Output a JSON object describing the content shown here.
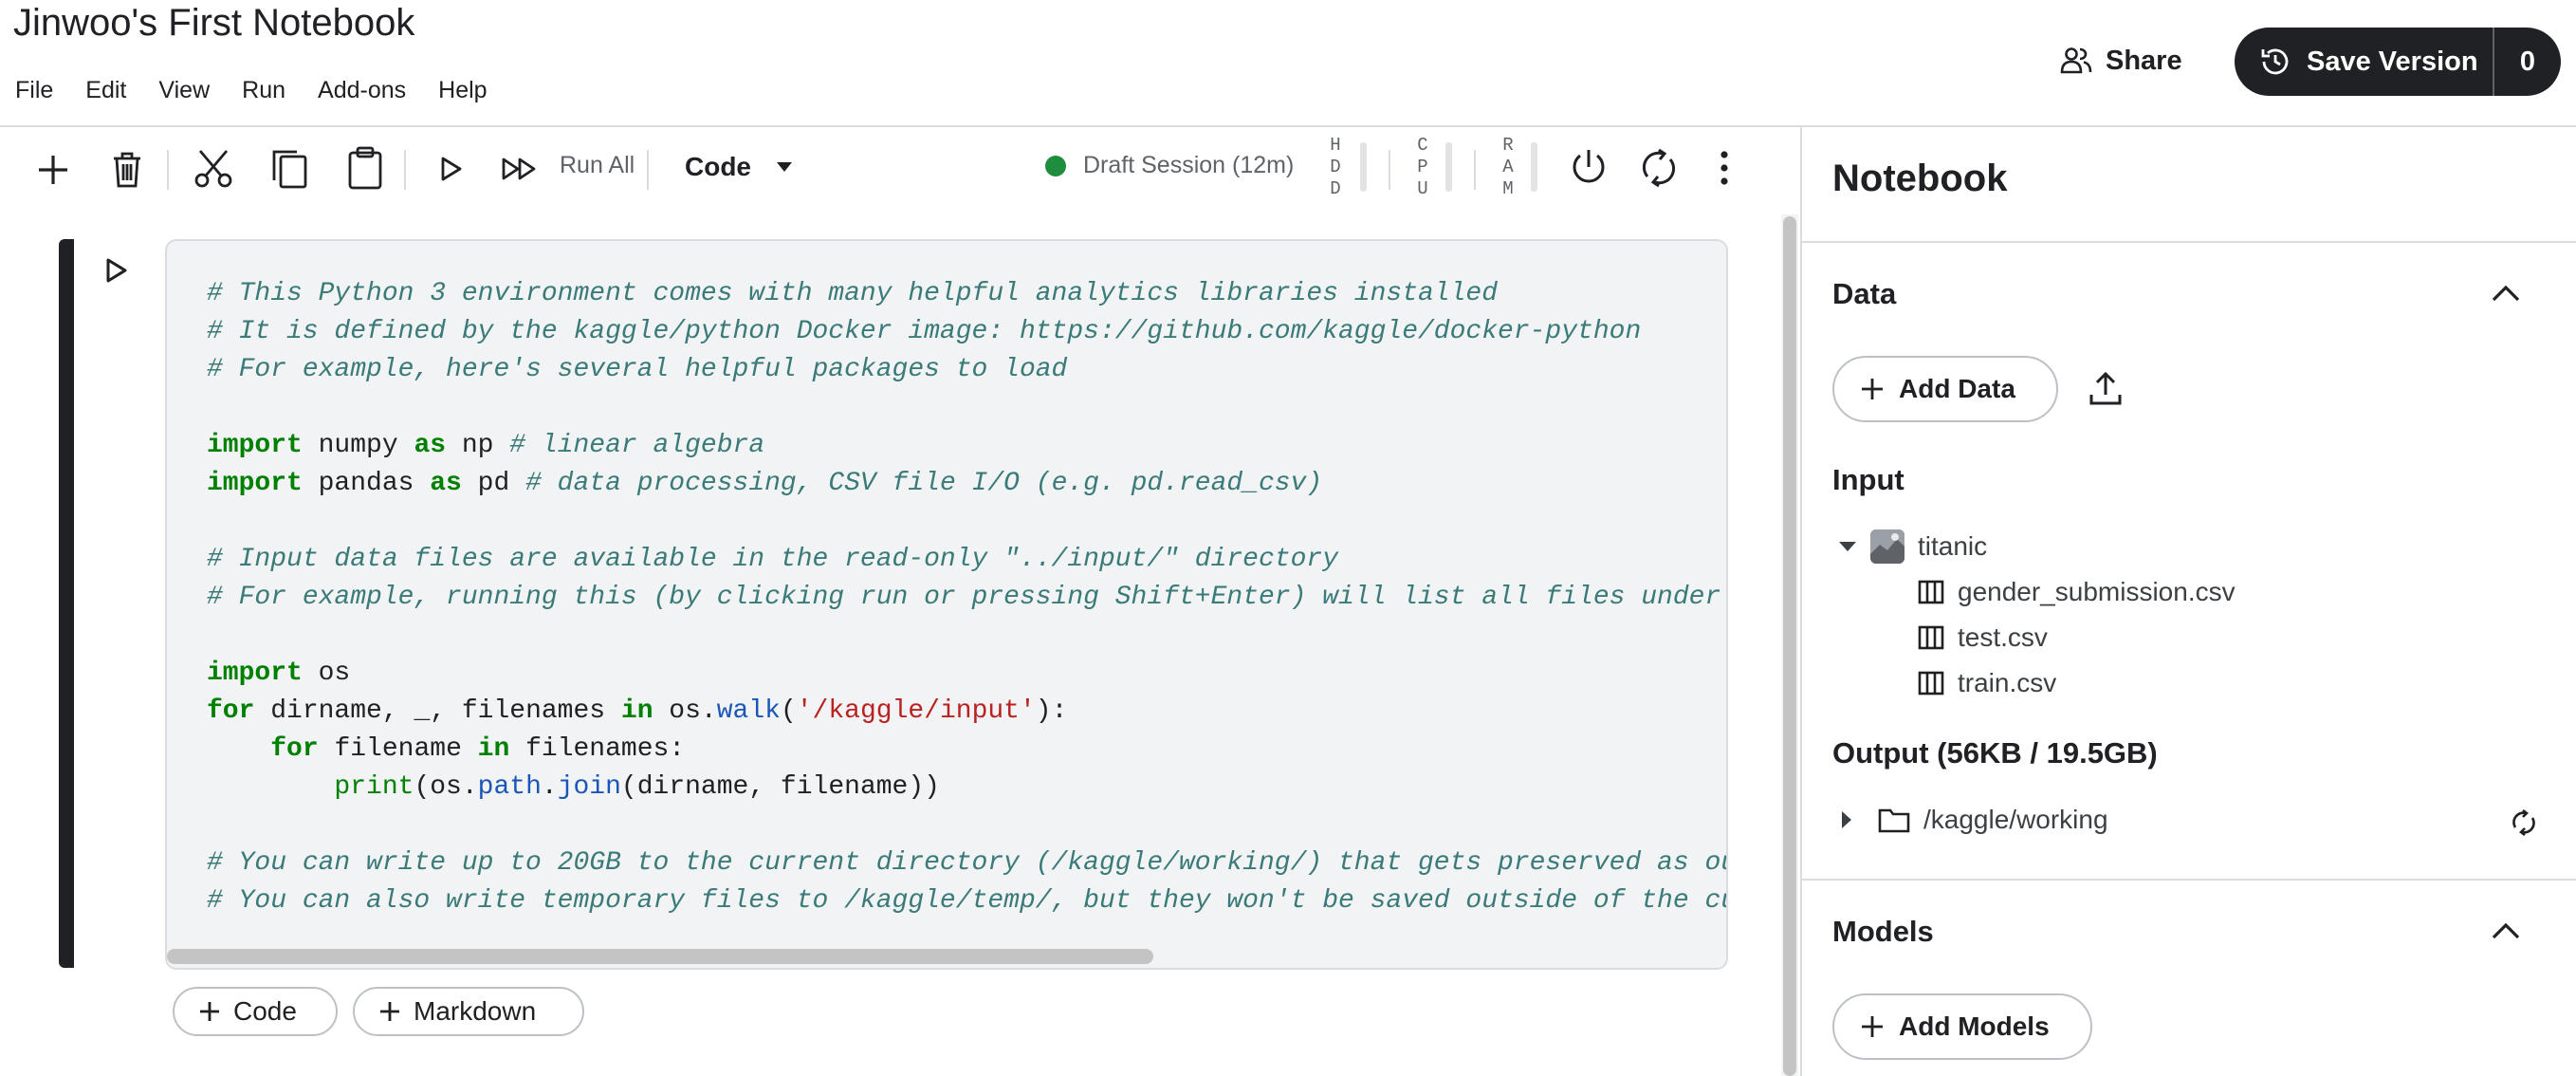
{
  "header": {
    "notebook_title": "Jinwoo's First Notebook",
    "menu": [
      "File",
      "Edit",
      "View",
      "Run",
      "Add-ons",
      "Help"
    ],
    "share_label": "Share",
    "save_version_label": "Save Version",
    "save_version_count": "0"
  },
  "toolbar": {
    "run_all_label": "Run All",
    "cell_type": "Code",
    "session_label": "Draft Session (12m)",
    "session_status_color": "#1e8e3e",
    "resources": [
      {
        "label": [
          "H",
          "D",
          "D"
        ]
      },
      {
        "label": [
          "C",
          "P",
          "U"
        ]
      },
      {
        "label": [
          "R",
          "A",
          "M"
        ]
      }
    ]
  },
  "cell": {
    "lines": [
      [
        {
          "t": "cm",
          "v": "# This Python 3 environment comes with many helpful analytics libraries installed"
        }
      ],
      [
        {
          "t": "cm",
          "v": "# It is defined by the kaggle/python Docker image: https://github.com/kaggle/docker-python"
        }
      ],
      [
        {
          "t": "cm",
          "v": "# For example, here's several helpful packages to load"
        }
      ],
      [],
      [
        {
          "t": "kw",
          "v": "import"
        },
        {
          "t": "",
          "v": " numpy "
        },
        {
          "t": "kw",
          "v": "as"
        },
        {
          "t": "",
          "v": " np "
        },
        {
          "t": "cm",
          "v": "# linear algebra"
        }
      ],
      [
        {
          "t": "kw",
          "v": "import"
        },
        {
          "t": "",
          "v": " pandas "
        },
        {
          "t": "kw",
          "v": "as"
        },
        {
          "t": "",
          "v": " pd "
        },
        {
          "t": "cm",
          "v": "# data processing, CSV file I/O (e.g. pd.read_csv)"
        }
      ],
      [],
      [
        {
          "t": "cm",
          "v": "# Input data files are available in the read-only \"../input/\" directory"
        }
      ],
      [
        {
          "t": "cm",
          "v": "# For example, running this (by clicking run or pressing Shift+Enter) will list all files under"
        }
      ],
      [],
      [
        {
          "t": "kw",
          "v": "import"
        },
        {
          "t": "",
          "v": " os"
        }
      ],
      [
        {
          "t": "kw",
          "v": "for"
        },
        {
          "t": "",
          "v": " dirname, _, filenames "
        },
        {
          "t": "kw",
          "v": "in"
        },
        {
          "t": "",
          "v": " os."
        },
        {
          "t": "fn",
          "v": "walk"
        },
        {
          "t": "",
          "v": "("
        },
        {
          "t": "st",
          "v": "'/kaggle/input'"
        },
        {
          "t": "",
          "v": "):"
        }
      ],
      [
        {
          "t": "",
          "v": "    "
        },
        {
          "t": "kw",
          "v": "for"
        },
        {
          "t": "",
          "v": " filename "
        },
        {
          "t": "kw",
          "v": "in"
        },
        {
          "t": "",
          "v": " filenames:"
        }
      ],
      [
        {
          "t": "",
          "v": "        "
        },
        {
          "t": "bi",
          "v": "print"
        },
        {
          "t": "",
          "v": "(os."
        },
        {
          "t": "fn",
          "v": "path"
        },
        {
          "t": "",
          "v": "."
        },
        {
          "t": "fn",
          "v": "join"
        },
        {
          "t": "",
          "v": "(dirname, filename))"
        }
      ],
      [],
      [
        {
          "t": "cm",
          "v": "# You can write up to 20GB to the current directory (/kaggle/working/) that gets preserved as ou"
        }
      ],
      [
        {
          "t": "cm",
          "v": "# You can also write temporary files to /kaggle/temp/, but they won't be saved outside of the cu"
        }
      ]
    ]
  },
  "cell_actions": {
    "add_code_label": "Code",
    "add_markdown_label": "Markdown"
  },
  "panel": {
    "title": "Notebook",
    "data": {
      "title": "Data",
      "add_data_label": "Add Data",
      "input_title": "Input",
      "dataset": "titanic",
      "files": [
        "gender_submission.csv",
        "test.csv",
        "train.csv"
      ],
      "output_title": "Output (56KB / 19.5GB)",
      "output_path": "/kaggle/working"
    },
    "models": {
      "title": "Models",
      "add_models_label": "Add Models"
    }
  }
}
